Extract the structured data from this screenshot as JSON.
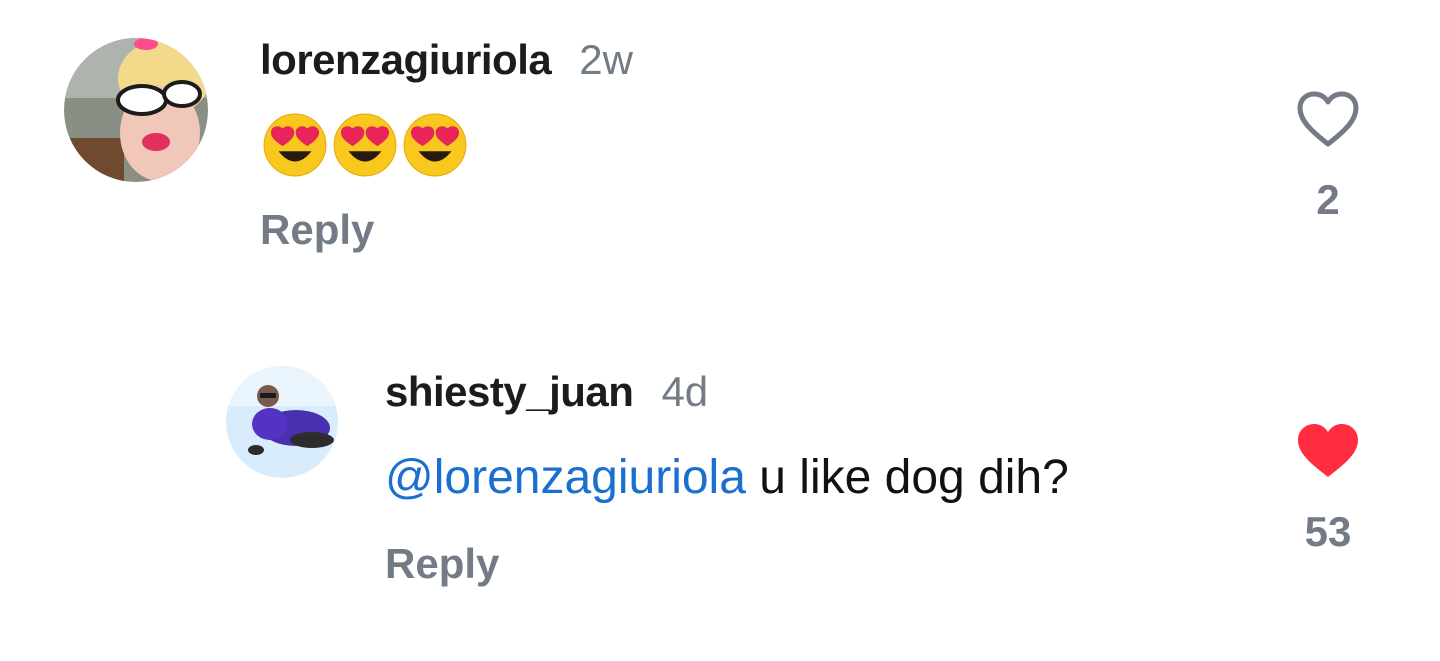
{
  "comments": [
    {
      "username": "lorenzagiuriola",
      "timestamp": "2w",
      "emojis": [
        "heart-eyes-emoji",
        "heart-eyes-emoji",
        "heart-eyes-emoji"
      ],
      "reply_label": "Reply",
      "like_count": "2",
      "liked": false
    },
    {
      "username": "shiesty_juan",
      "timestamp": "4d",
      "mention": "@lorenzagiuriola",
      "text": " u like dog dih?",
      "reply_label": "Reply",
      "like_count": "53",
      "liked": true
    }
  ],
  "colors": {
    "username": "#1c1c1c",
    "muted": "#737b86",
    "mention": "#1a6fd0",
    "like_active": "#ff2d3f"
  }
}
